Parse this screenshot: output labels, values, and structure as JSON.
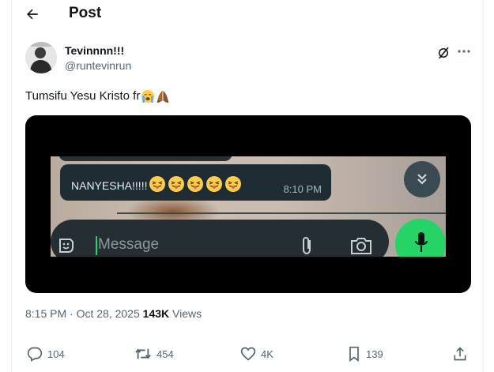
{
  "header": {
    "title": "Post",
    "back_icon": "arrow-left-icon"
  },
  "author": {
    "display_name": "Tevinnnn!!!",
    "handle": "@runtevinrun",
    "avatar_icon": "avatar-photo"
  },
  "post": {
    "text": "Tumsifu Yesu Kristo fr",
    "emojis": [
      "loudly-crying-face",
      "folded-hands"
    ]
  },
  "media": {
    "chat_message": "NANYESHA!!!!!",
    "chat_emoji_count": 5,
    "chat_time": "8:10 PM",
    "input_placeholder": "Message",
    "accent_color": "#25d366"
  },
  "meta": {
    "time": "8:15 PM",
    "separator": "·",
    "date": "Oct 28, 2025",
    "views_count": "143K",
    "views_label": "Views"
  },
  "actions": {
    "replies": "104",
    "reposts": "454",
    "likes": "4K",
    "bookmarks": "139"
  }
}
